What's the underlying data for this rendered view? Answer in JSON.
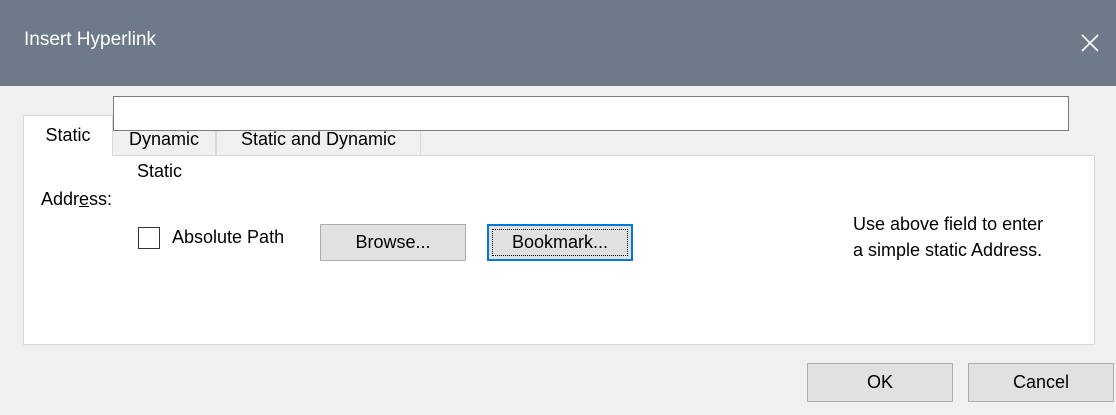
{
  "window": {
    "title": "Insert Hyperlink"
  },
  "tabs": [
    {
      "label": "Static",
      "active": true
    },
    {
      "label": "Dynamic",
      "active": false
    },
    {
      "label": "Static and Dynamic",
      "active": false
    }
  ],
  "static_panel": {
    "group_label": "Static",
    "address_label_pre": "Addr",
    "address_label_u": "e",
    "address_label_post": "ss:",
    "address_value": "",
    "absolute_path_label": "Absolute Path",
    "absolute_path_checked": false,
    "browse_label": "Browse...",
    "bookmark_label": "Bookmark...",
    "hint_line1": "Use above field to enter",
    "hint_line2": "a simple static Address."
  },
  "footer": {
    "ok_label": "OK",
    "cancel_label": "Cancel"
  },
  "colors": {
    "titlebar": "#6e7a8a",
    "focus_border": "#0078d7"
  },
  "icons": {
    "close": "close-icon"
  }
}
